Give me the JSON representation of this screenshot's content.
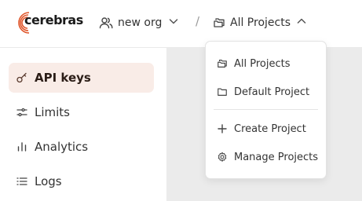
{
  "brand": {
    "name": "cerebras",
    "accent": "#e0562b"
  },
  "header": {
    "org_label": "new org",
    "separator": "/",
    "project_label": "All Projects"
  },
  "sidebar": {
    "items": [
      {
        "label": "API keys",
        "icon": "key-icon",
        "active": true
      },
      {
        "label": "Limits",
        "icon": "sliders-icon",
        "active": false
      },
      {
        "label": "Analytics",
        "icon": "bar-chart-icon",
        "active": false
      },
      {
        "label": "Logs",
        "icon": "list-icon",
        "active": false
      }
    ]
  },
  "project_menu": {
    "items": [
      {
        "label": "All Projects",
        "icon": "folders-icon"
      },
      {
        "label": "Default Project",
        "icon": "folder-icon"
      },
      {
        "label": "Create Project",
        "icon": "plus-icon"
      },
      {
        "label": "Manage Projects",
        "icon": "gear-icon"
      }
    ]
  },
  "colors": {
    "active_bg": "#f9ece7",
    "main_bg": "#ebebeb"
  }
}
